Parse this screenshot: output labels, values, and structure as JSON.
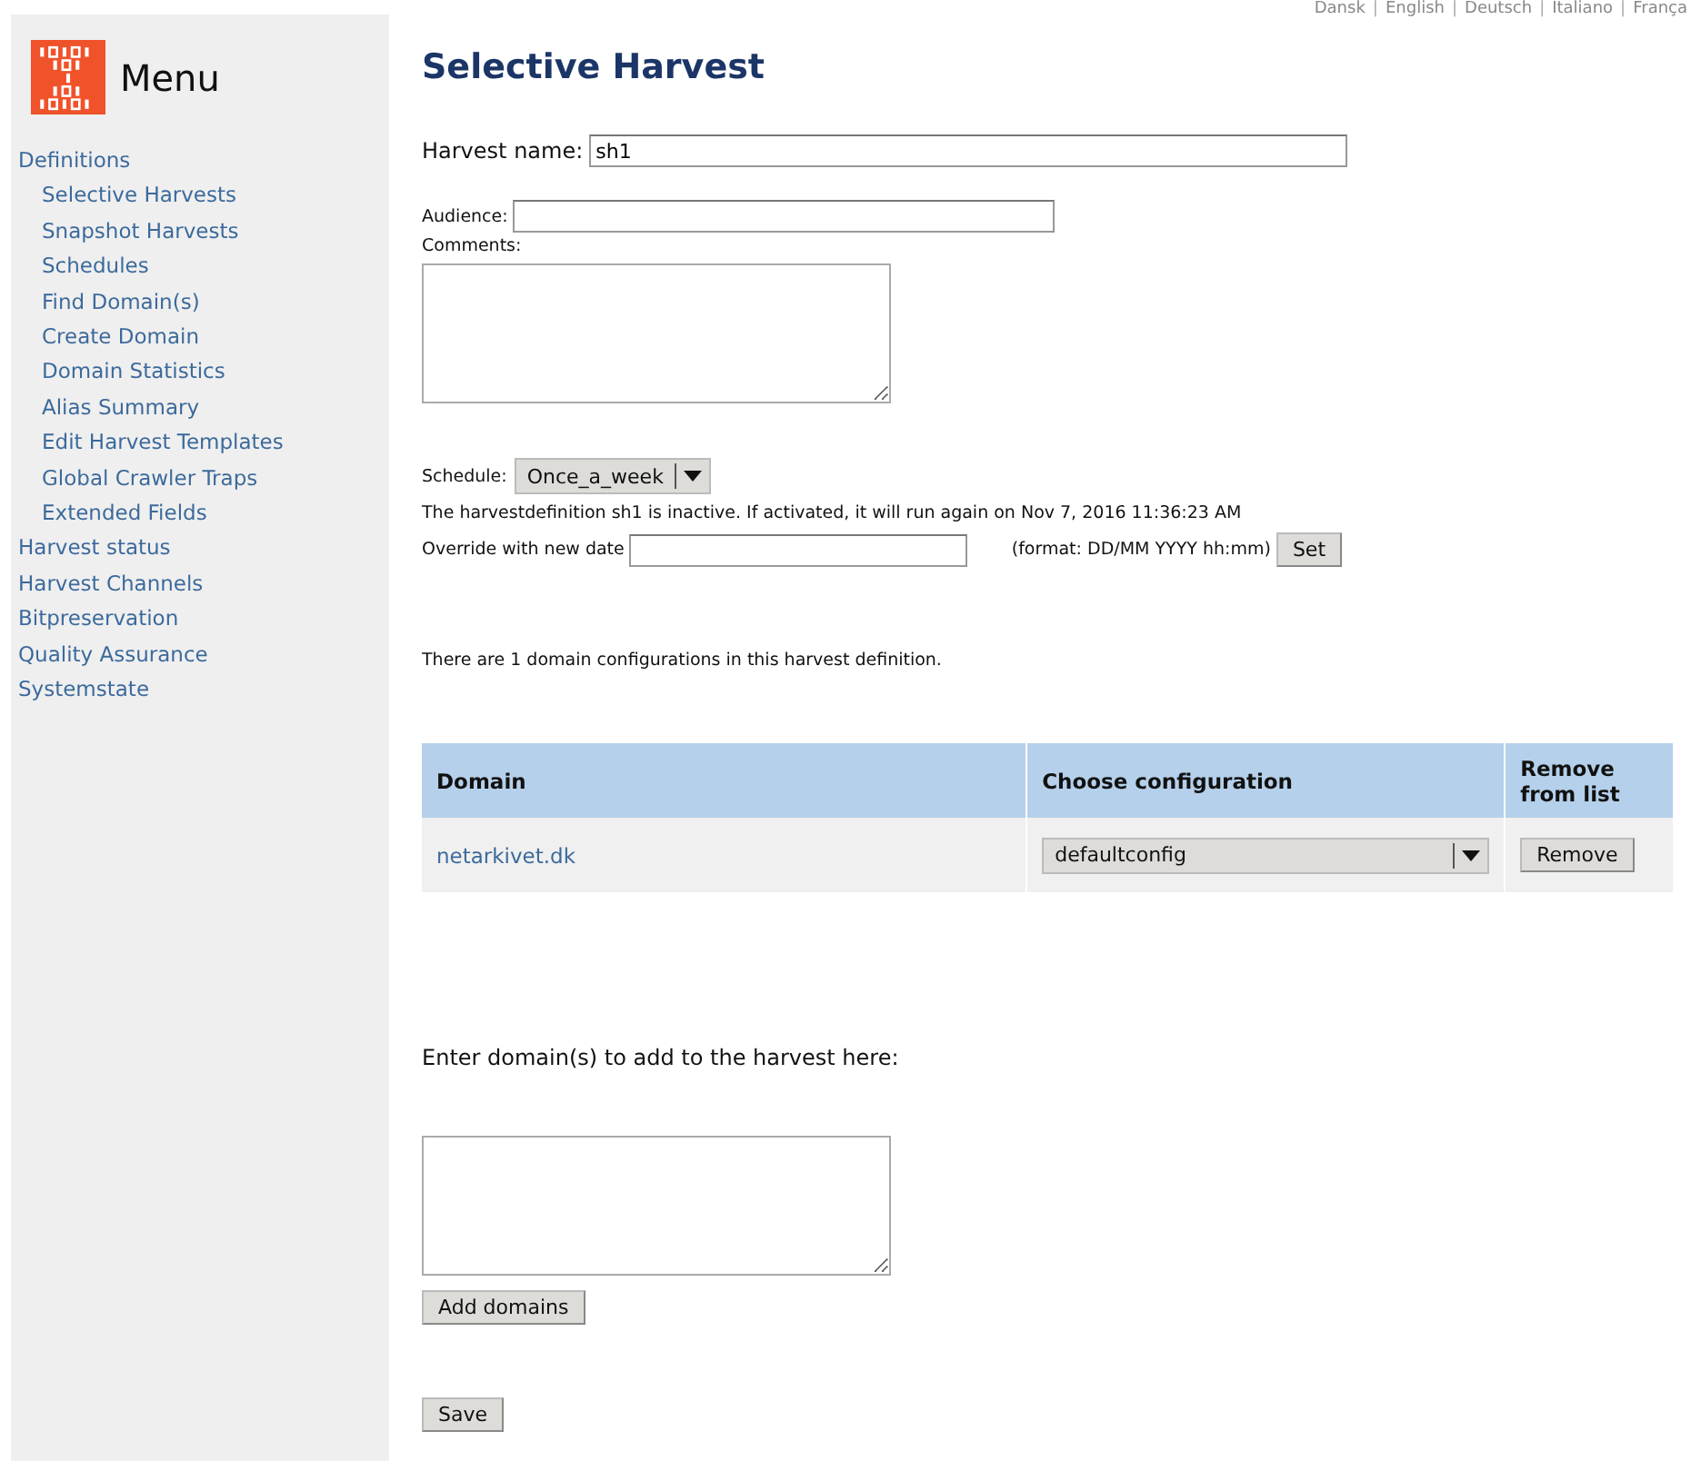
{
  "languages": {
    "separator": "|",
    "items": [
      "Dansk",
      "English",
      "Deutsch",
      "Italiano",
      "França"
    ]
  },
  "menu": {
    "title": "Menu",
    "items": [
      {
        "label": "Definitions",
        "children": [
          {
            "label": "Selective Harvests"
          },
          {
            "label": "Snapshot Harvests"
          },
          {
            "label": "Schedules"
          },
          {
            "label": "Find Domain(s)"
          },
          {
            "label": "Create Domain"
          },
          {
            "label": "Domain Statistics"
          },
          {
            "label": "Alias Summary"
          },
          {
            "label": "Edit Harvest Templates"
          },
          {
            "label": "Global Crawler Traps"
          },
          {
            "label": "Extended Fields"
          }
        ]
      },
      {
        "label": "Harvest status"
      },
      {
        "label": "Harvest Channels"
      },
      {
        "label": "Bitpreservation"
      },
      {
        "label": "Quality Assurance"
      },
      {
        "label": "Systemstate"
      }
    ]
  },
  "title": "Selective Harvest",
  "harvest_name": {
    "label": "Harvest name:",
    "value": "sh1"
  },
  "audience": {
    "label": "Audience:"
  },
  "comments": {
    "label": "Comments:"
  },
  "schedule": {
    "label": "Schedule:",
    "value": "Once_a_week"
  },
  "status_text": "The harvestdefinition sh1 is inactive. If activated, it will run again on Nov 7, 2016 11:36:23 AM",
  "override": {
    "label": "Override with new date",
    "format": "(format: DD/MM YYYY hh:mm)",
    "button": "Set"
  },
  "domain_count_text": "There are 1 domain configurations in this harvest definition.",
  "table": {
    "columns": [
      "Domain",
      "Choose configuration",
      "Remove from list"
    ],
    "rows": [
      {
        "domain": "netarkivet.dk",
        "configuration": "defaultconfig",
        "button": "Remove"
      }
    ]
  },
  "add_domains": {
    "label": "Enter domain(s) to add to the harvest here:",
    "button": "Add domains"
  },
  "save_button": "Save"
}
